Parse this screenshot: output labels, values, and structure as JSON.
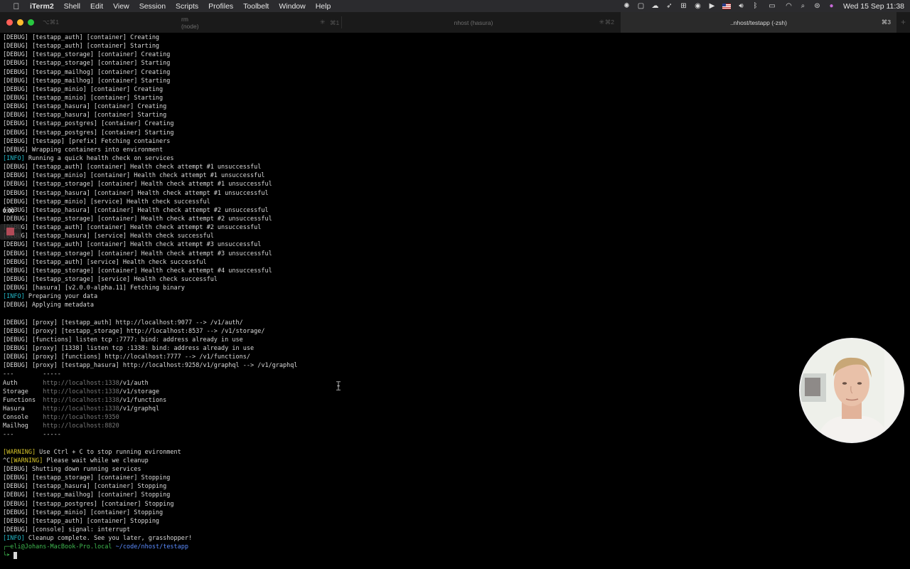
{
  "menubar": {
    "apple_icon": "apple-icon",
    "app_name": "iTerm2",
    "items": [
      "Shell",
      "Edit",
      "View",
      "Session",
      "Scripts",
      "Profiles",
      "Toolbelt",
      "Window",
      "Help"
    ],
    "status_icons": [
      "brightness-icon",
      "stop-square-icon",
      "cloud-sync-icon",
      "rocket-icon",
      "window-grid-icon",
      "onepassword-icon",
      "play-icon",
      "us-flag-icon",
      "volume-icon",
      "bluetooth-icon",
      "battery-icon",
      "wifi-icon",
      "search-icon",
      "control-center-icon",
      "siri-icon"
    ],
    "clock": "Wed 15 Sep  11:38"
  },
  "tabs": [
    {
      "left_shortcut": "⌥⌘1",
      "title": "rm (node)",
      "shortcut": "⌘1",
      "active": false
    },
    {
      "title": "nhost (hasura)",
      "shortcut": "⌘2",
      "active": false
    },
    {
      "title": "..nhost/testapp (-zsh)",
      "shortcut": "⌘3",
      "active": true
    }
  ],
  "terminal": {
    "lines": [
      [
        {
          "t": "[DEBUG] [testapp_auth] [container] Creating"
        }
      ],
      [
        {
          "t": "[DEBUG] [testapp_auth] [container] Starting"
        }
      ],
      [
        {
          "t": "[DEBUG] [testapp_storage] [container] Creating"
        }
      ],
      [
        {
          "t": "[DEBUG] [testapp_storage] [container] Starting"
        }
      ],
      [
        {
          "t": "[DEBUG] [testapp_mailhog] [container] Creating"
        }
      ],
      [
        {
          "t": "[DEBUG] [testapp_mailhog] [container] Starting"
        }
      ],
      [
        {
          "t": "[DEBUG] [testapp_minio] [container] Creating"
        }
      ],
      [
        {
          "t": "[DEBUG] [testapp_minio] [container] Starting"
        }
      ],
      [
        {
          "t": "[DEBUG] [testapp_hasura] [container] Creating"
        }
      ],
      [
        {
          "t": "[DEBUG] [testapp_hasura] [container] Starting"
        }
      ],
      [
        {
          "t": "[DEBUG] [testapp_postgres] [container] Creating"
        }
      ],
      [
        {
          "t": "[DEBUG] [testapp_postgres] [container] Starting"
        }
      ],
      [
        {
          "t": "[DEBUG] [testapp] [prefix] Fetching containers"
        }
      ],
      [
        {
          "t": "[DEBUG] Wrapping containers into environment"
        }
      ],
      [
        {
          "t": "[INFO]",
          "c": "info"
        },
        {
          "t": " Running a quick health check on services"
        }
      ],
      [
        {
          "t": "[DEBUG] [testapp_auth] [container] Health check attempt #1 unsuccessful"
        }
      ],
      [
        {
          "t": "[DEBUG] [testapp_minio] [container] Health check attempt #1 unsuccessful"
        }
      ],
      [
        {
          "t": "[DEBUG] [testapp_storage] [container] Health check attempt #1 unsuccessful"
        }
      ],
      [
        {
          "t": "[DEBUG] [testapp_hasura] [container] Health check attempt #1 unsuccessful"
        }
      ],
      [
        {
          "t": "[DEBUG] [testapp_minio] [service] Health check successful"
        }
      ],
      [
        {
          "t": "[DEBUG] [testapp_hasura] [container] Health check attempt #2 unsuccessful"
        }
      ],
      [
        {
          "t": "[DEBUG] [testapp_storage] [container] Health check attempt #2 unsuccessful"
        }
      ],
      [
        {
          "t": "[DEBUG] [testapp_auth] [container] Health check attempt #2 unsuccessful"
        }
      ],
      [
        {
          "t": "[DEBUG] [testapp_hasura] [service] Health check successful"
        }
      ],
      [
        {
          "t": "[DEBUG] [testapp_auth] [container] Health check attempt #3 unsuccessful"
        }
      ],
      [
        {
          "t": "[DEBUG] [testapp_storage] [container] Health check attempt #3 unsuccessful"
        }
      ],
      [
        {
          "t": "[DEBUG] [testapp_auth] [service] Health check successful"
        }
      ],
      [
        {
          "t": "[DEBUG] [testapp_storage] [container] Health check attempt #4 unsuccessful"
        }
      ],
      [
        {
          "t": "[DEBUG] [testapp_storage] [service] Health check successful"
        }
      ],
      [
        {
          "t": "[DEBUG] [hasura] [v2.0.0-alpha.11] Fetching binary"
        }
      ],
      [
        {
          "t": "[INFO]",
          "c": "info"
        },
        {
          "t": " Preparing your data"
        }
      ],
      [
        {
          "t": "[DEBUG] Applying metadata"
        }
      ],
      [
        {
          "t": ""
        }
      ],
      [
        {
          "t": "[DEBUG] [proxy] [testapp_auth] http://localhost:9077 --> /v1/auth/"
        }
      ],
      [
        {
          "t": "[DEBUG] [proxy] [testapp_storage] http://localhost:8537 --> /v1/storage/"
        }
      ],
      [
        {
          "t": "[DEBUG] [functions] listen tcp :7777: bind: address already in use"
        }
      ],
      [
        {
          "t": "[DEBUG] [proxy] [1338] listen tcp :1338: bind: address already in use"
        }
      ],
      [
        {
          "t": "[DEBUG] [proxy] [functions] http://localhost:7777 --> /v1/functions/"
        }
      ],
      [
        {
          "t": "[DEBUG] [proxy] [testapp_hasura] http://localhost:9258/v1/graphql --> /v1/graphql"
        }
      ],
      [
        {
          "t": "---        -----"
        }
      ],
      [
        {
          "t": "Auth       "
        },
        {
          "t": "http://localhost:1338",
          "c": "url"
        },
        {
          "t": "/v1/auth"
        }
      ],
      [
        {
          "t": "Storage    "
        },
        {
          "t": "http://localhost:1338",
          "c": "url"
        },
        {
          "t": "/v1/storage"
        }
      ],
      [
        {
          "t": "Functions  "
        },
        {
          "t": "http://localhost:1338",
          "c": "url"
        },
        {
          "t": "/v1/functions"
        }
      ],
      [
        {
          "t": "Hasura     "
        },
        {
          "t": "http://localhost:1338",
          "c": "url"
        },
        {
          "t": "/v1/graphql"
        }
      ],
      [
        {
          "t": "Console    "
        },
        {
          "t": "http://localhost:9350",
          "c": "url"
        }
      ],
      [
        {
          "t": "Mailhog    "
        },
        {
          "t": "http://localhost:8820",
          "c": "url"
        }
      ],
      [
        {
          "t": "---        -----"
        }
      ],
      [
        {
          "t": ""
        }
      ],
      [
        {
          "t": "[WARNING]",
          "c": "warn"
        },
        {
          "t": " Use Ctrl + C to stop running evironment"
        }
      ],
      [
        {
          "t": "^C"
        },
        {
          "t": "[WARNING]",
          "c": "warn"
        },
        {
          "t": " Please wait while we cleanup"
        }
      ],
      [
        {
          "t": "[DEBUG] Shutting down running services"
        }
      ],
      [
        {
          "t": "[DEBUG] [testapp_storage] [container] Stopping"
        }
      ],
      [
        {
          "t": "[DEBUG] [testapp_hasura] [container] Stopping"
        }
      ],
      [
        {
          "t": "[DEBUG] [testapp_mailhog] [container] Stopping"
        }
      ],
      [
        {
          "t": "[DEBUG] [testapp_postgres] [container] Stopping"
        }
      ],
      [
        {
          "t": "[DEBUG] [testapp_minio] [container] Stopping"
        }
      ],
      [
        {
          "t": "[DEBUG] [testapp_auth] [container] Stopping"
        }
      ],
      [
        {
          "t": "[DEBUG] [console] signal: interrupt"
        }
      ],
      [
        {
          "t": "[INFO]",
          "c": "info"
        },
        {
          "t": " Cleanup complete. See you later, grasshopper!"
        }
      ],
      [
        {
          "t": "┌─",
          "c": "prompt-user"
        },
        {
          "t": "eli@Johans-MacBook-Pro.local",
          "c": "prompt-user"
        },
        {
          "t": " "
        },
        {
          "t": "~/code/nhost/testapp",
          "c": "prompt-path"
        }
      ],
      [
        {
          "t": "└➤ ",
          "c": "prompt-user"
        }
      ]
    ]
  },
  "recorder": {
    "elapsed": "0:00"
  },
  "colors": {
    "info": "#22b8c8",
    "warning": "#d5c32a",
    "url": "#7a7a7a",
    "prompt_user": "#3fb950",
    "prompt_path": "#5b8cff"
  }
}
